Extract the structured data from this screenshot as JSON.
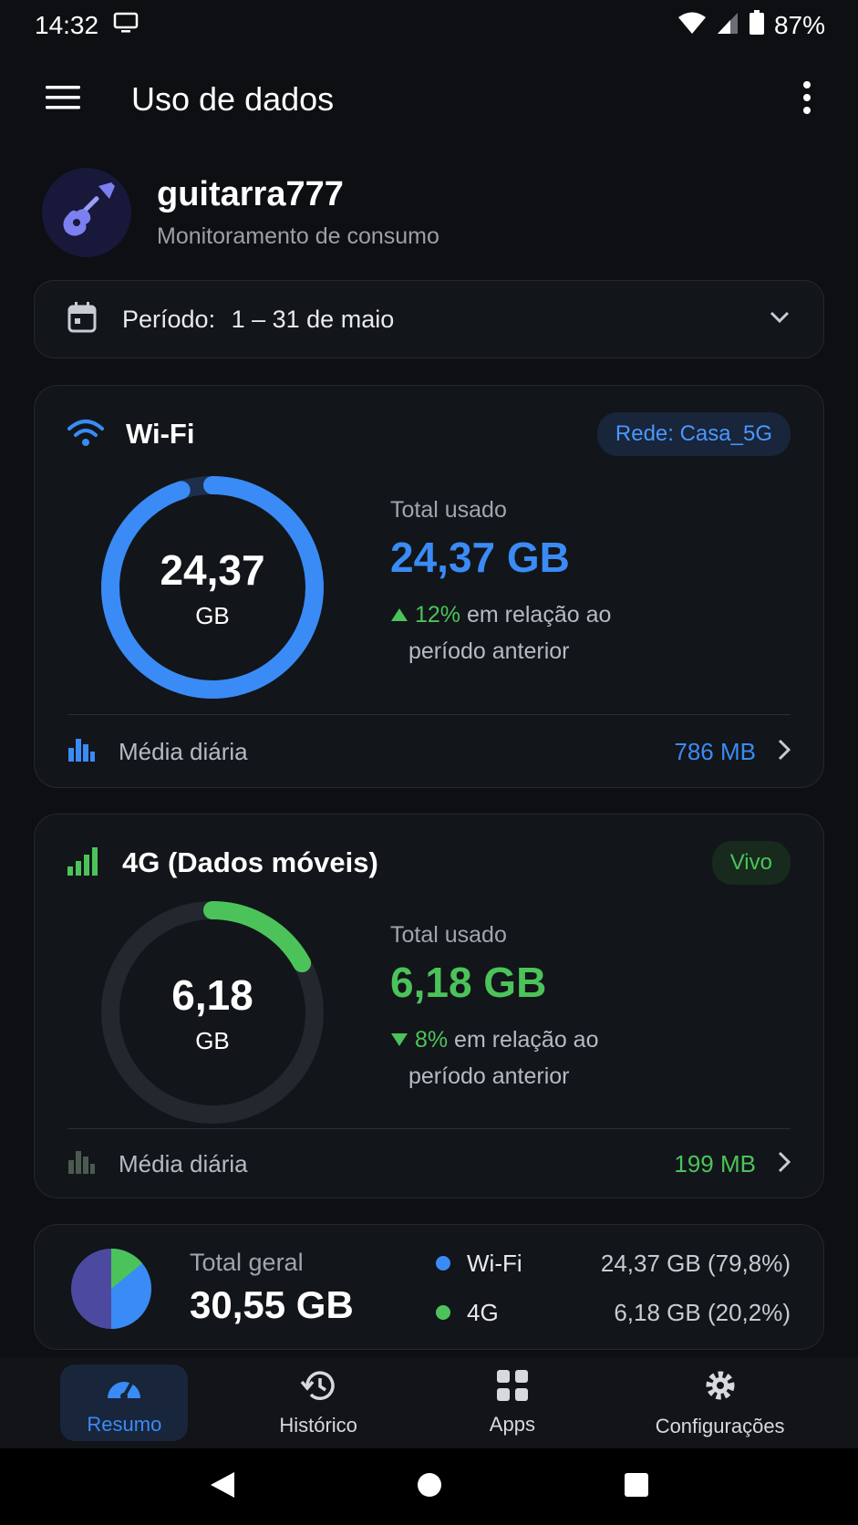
{
  "status_bar": {
    "time": "14:32",
    "battery": "87%",
    "icons": [
      "screen-cast-icon",
      "wifi-icon",
      "signal-icon",
      "battery-icon"
    ]
  },
  "app_bar": {
    "title": "Uso de dados",
    "menu_icon": "hamburger-menu-icon",
    "more_icon": "more-vert-icon"
  },
  "profile": {
    "name": "guitarra777",
    "subtitle": "Monitoramento de consumo",
    "avatar_icon": "guitar-icon"
  },
  "period": {
    "label": "Período:",
    "value": "1 – 31 de maio"
  },
  "wifi": {
    "title": "Wi-Fi",
    "badge": "Rede: Casa_5G",
    "donut_value": "24,37",
    "donut_unit": "GB",
    "donut_fraction": 0.95,
    "total_label": "Total usado",
    "total_value": "24,37 GB",
    "change_pct": "12%",
    "change_dir": "up",
    "change_text": "em relação ao",
    "change_text2": "período anterior",
    "avg_label": "Média diária",
    "avg_value": "786 MB",
    "color": "#3a8bf5"
  },
  "mobile": {
    "title": "4G (Dados móveis)",
    "badge": "Vivo",
    "donut_value": "6,18",
    "donut_unit": "GB",
    "donut_fraction": 0.17,
    "total_label": "Total usado",
    "total_value": "6,18 GB",
    "change_pct": "8%",
    "change_dir": "down",
    "change_text": "em relação ao",
    "change_text2": "período anterior",
    "avg_label": "Média diária",
    "avg_value": "199 MB",
    "color": "#4cc35a"
  },
  "total": {
    "label": "Total geral",
    "value": "30,55 GB",
    "legend": [
      {
        "name": "Wi-Fi",
        "value": "24,37 GB (79,8%)",
        "color": "#3a8bf5"
      },
      {
        "name": "4G",
        "value": "6,18 GB (20,2%)",
        "color": "#4cc35a"
      }
    ]
  },
  "bottom_nav": [
    {
      "label": "Resumo",
      "icon": "speedometer-icon",
      "active": true
    },
    {
      "label": "Histórico",
      "icon": "history-icon",
      "active": false
    },
    {
      "label": "Apps",
      "icon": "apps-grid-icon",
      "active": false
    },
    {
      "label": "Configurações",
      "icon": "gear-icon",
      "active": false
    }
  ]
}
